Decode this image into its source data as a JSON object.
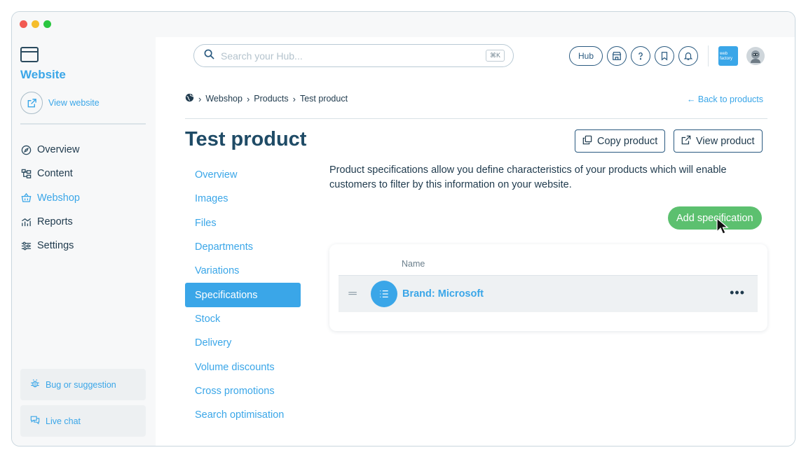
{
  "sidebar": {
    "site_title": "Website",
    "view_site": "View website",
    "nav": [
      {
        "label": "Overview",
        "icon": "compass-icon"
      },
      {
        "label": "Content",
        "icon": "content-tree-icon"
      },
      {
        "label": "Webshop",
        "icon": "basket-icon"
      },
      {
        "label": "Reports",
        "icon": "chart-icon"
      },
      {
        "label": "Settings",
        "icon": "sliders-icon"
      }
    ],
    "active_nav": "Webshop",
    "bug_label": "Bug or suggestion",
    "chat_label": "Live chat"
  },
  "topbar": {
    "search_placeholder": "Search your Hub...",
    "search_shortcut": "⌘K",
    "hub_label": "Hub",
    "logo_text": "web factory"
  },
  "breadcrumb": {
    "items": [
      "Webshop",
      "Products",
      "Test product"
    ]
  },
  "back_link": "← Back to products",
  "page_title": "Test product",
  "actions": {
    "copy_label": "Copy product",
    "view_label": "View product"
  },
  "subnav": {
    "items": [
      "Overview",
      "Images",
      "Files",
      "Departments",
      "Variations",
      "Specifications",
      "Stock",
      "Delivery",
      "Volume discounts",
      "Cross promotions",
      "Search optimisation"
    ],
    "active": "Specifications"
  },
  "description": "Product specifications allow you define characteristics of your products which will enable customers to filter by this information on your website.",
  "add_spec_label": "Add specification",
  "spec_table": {
    "column_name": "Name",
    "rows": [
      {
        "name": "Brand: Microsoft"
      }
    ]
  },
  "colors": {
    "accent": "#3aa6e8",
    "primary_dark": "#1f4b66",
    "success": "#5cc06f"
  }
}
